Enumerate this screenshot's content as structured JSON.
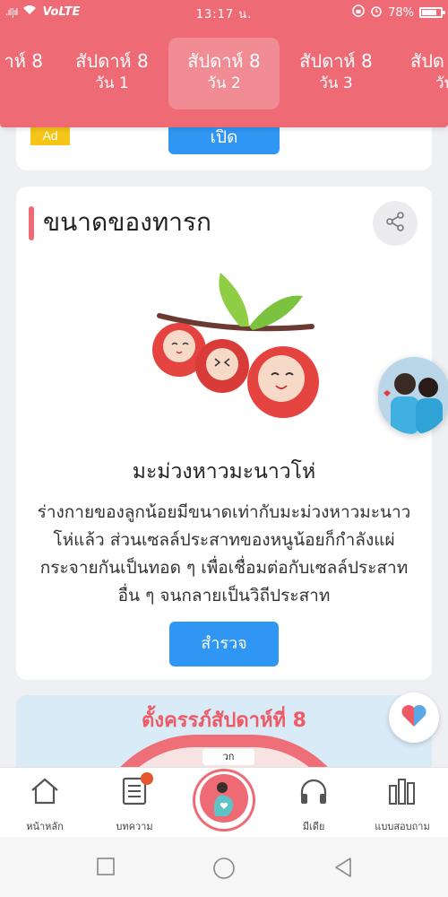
{
  "status_bar": {
    "signal": ".ıl|ıl",
    "network": "VoLTE",
    "time": "13:17 น.",
    "battery_text": "78%",
    "battery_level": 0.78
  },
  "week_tabs": [
    {
      "week": "าห์ 8",
      "day": ""
    },
    {
      "week": "สัปดาห์ 8",
      "day": "วัน 1"
    },
    {
      "week": "สัปดาห์ 8",
      "day": "วัน 2"
    },
    {
      "week": "สัปดาห์ 8",
      "day": "วัน 3"
    },
    {
      "week": "สัปด",
      "day": "วัน"
    }
  ],
  "ad_card": {
    "badge": "Ad",
    "button": "เปิด"
  },
  "baby_size_card": {
    "title": "ขนาดของทารก",
    "fruit_name": "มะม่วงหาวมะนาวโห่",
    "description": "ร่างกายของลูกน้อยมีขนาดเท่ากับมะม่วงหาวมะนาวโห่แล้ว ส่วนเซลล์ประสาทของหนูน้อยก็กำลังแผ่กระจายกันเป็นทอด ๆ เพื่อเชื่อมต่อกับเซลล์ประสาทอื่น ๆ จนกลายเป็นวิถีประสาท",
    "explore_button": "สำรวจ"
  },
  "preview_card": {
    "title": "ตั้งครรภ์สัปดาห์ที่ 8",
    "tag": "วก"
  },
  "bottom_nav": {
    "home": "หน้าหลัก",
    "articles": "บทความ",
    "media": "มีเดีย",
    "questionnaire": "แบบสอบถาม"
  },
  "colors": {
    "brand": "#ee6b76",
    "button": "#2f96f3",
    "ad": "#f5c518"
  }
}
